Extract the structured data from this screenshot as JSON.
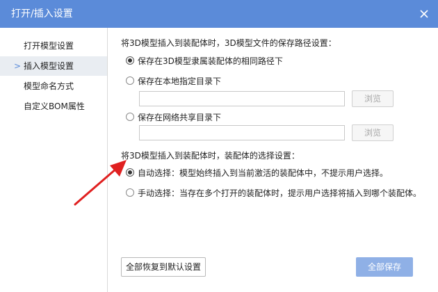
{
  "window": {
    "title": "打开/插入设置"
  },
  "sidebar": {
    "items": [
      {
        "label": "打开模型设置",
        "active": false
      },
      {
        "label": "插入模型设置",
        "active": true
      },
      {
        "label": "模型命名方式",
        "active": false
      },
      {
        "label": "自定义BOM属性",
        "active": false
      }
    ]
  },
  "path_section": {
    "title": "将3D模型插入到装配体时，3D模型文件的保存路径设置：",
    "options": [
      {
        "label": "保存在3D模型隶属装配体的相同路径下",
        "checked": true
      },
      {
        "label": "保存在本地指定目录下",
        "checked": false,
        "input_value": "",
        "browse_label": "浏览"
      },
      {
        "label": "保存在网络共享目录下",
        "checked": false,
        "input_value": "",
        "browse_label": "浏览"
      }
    ]
  },
  "select_section": {
    "title": "将3D模型插入到装配体时，装配体的选择设置：",
    "options": [
      {
        "label": "自动选择：模型始终插入到当前激活的装配体中，不提示用户选择。",
        "checked": true
      },
      {
        "label": "手动选择：当存在多个打开的装配体时，提示用户选择将插入到哪个装配体。",
        "checked": false
      }
    ]
  },
  "footer": {
    "reset_label": "全部恢复到默认设置",
    "save_label": "全部保存"
  },
  "colors": {
    "titlebar": "#5b8bd9",
    "save_button": "#8fb0e6",
    "annotation_arrow": "#e02020"
  }
}
